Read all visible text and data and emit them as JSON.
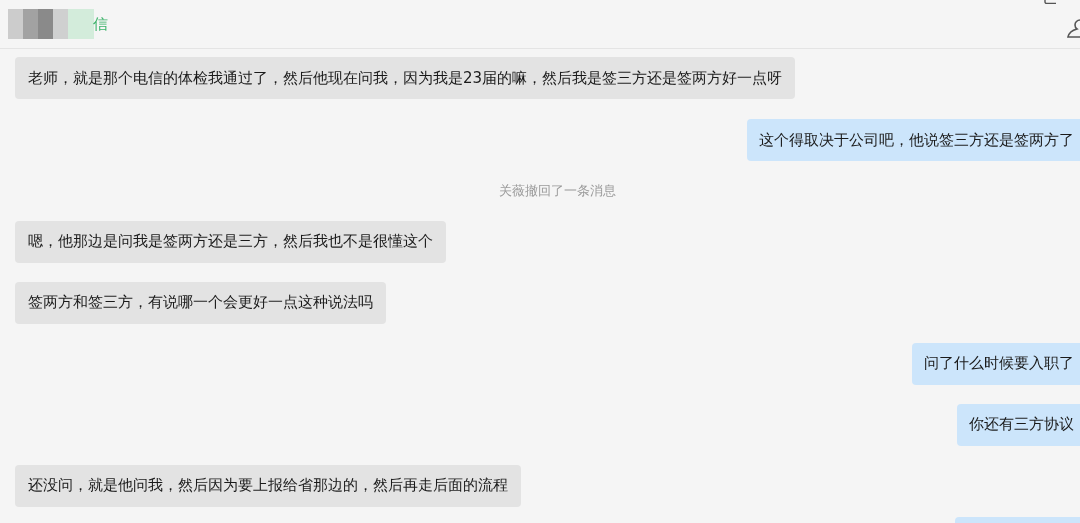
{
  "header": {
    "title": "信"
  },
  "messages": [
    {
      "kind": "incoming",
      "text": "老师，就是那个电信的体检我通过了，然后他现在问我，因为我是23届的嘛，然后我是签三方还是签两方好一点呀"
    },
    {
      "kind": "outgoing",
      "text": "这个得取决于公司吧，他说签三方还是签两方了"
    },
    {
      "kind": "system",
      "text": "关薇撤回了一条消息"
    },
    {
      "kind": "incoming",
      "text": "嗯，他那边是问我是签两方还是三方，然后我也不是很懂这个"
    },
    {
      "kind": "incoming",
      "text": "签两方和签三方，有说哪一个会更好一点这种说法吗"
    },
    {
      "kind": "outgoing",
      "text": "问了什么时候要入职了"
    },
    {
      "kind": "outgoing",
      "text": "你还有三方协议"
    },
    {
      "kind": "incoming",
      "text": "还没问，就是他问我，然后因为要上报给省那边的，然后再走后面的流程"
    }
  ]
}
